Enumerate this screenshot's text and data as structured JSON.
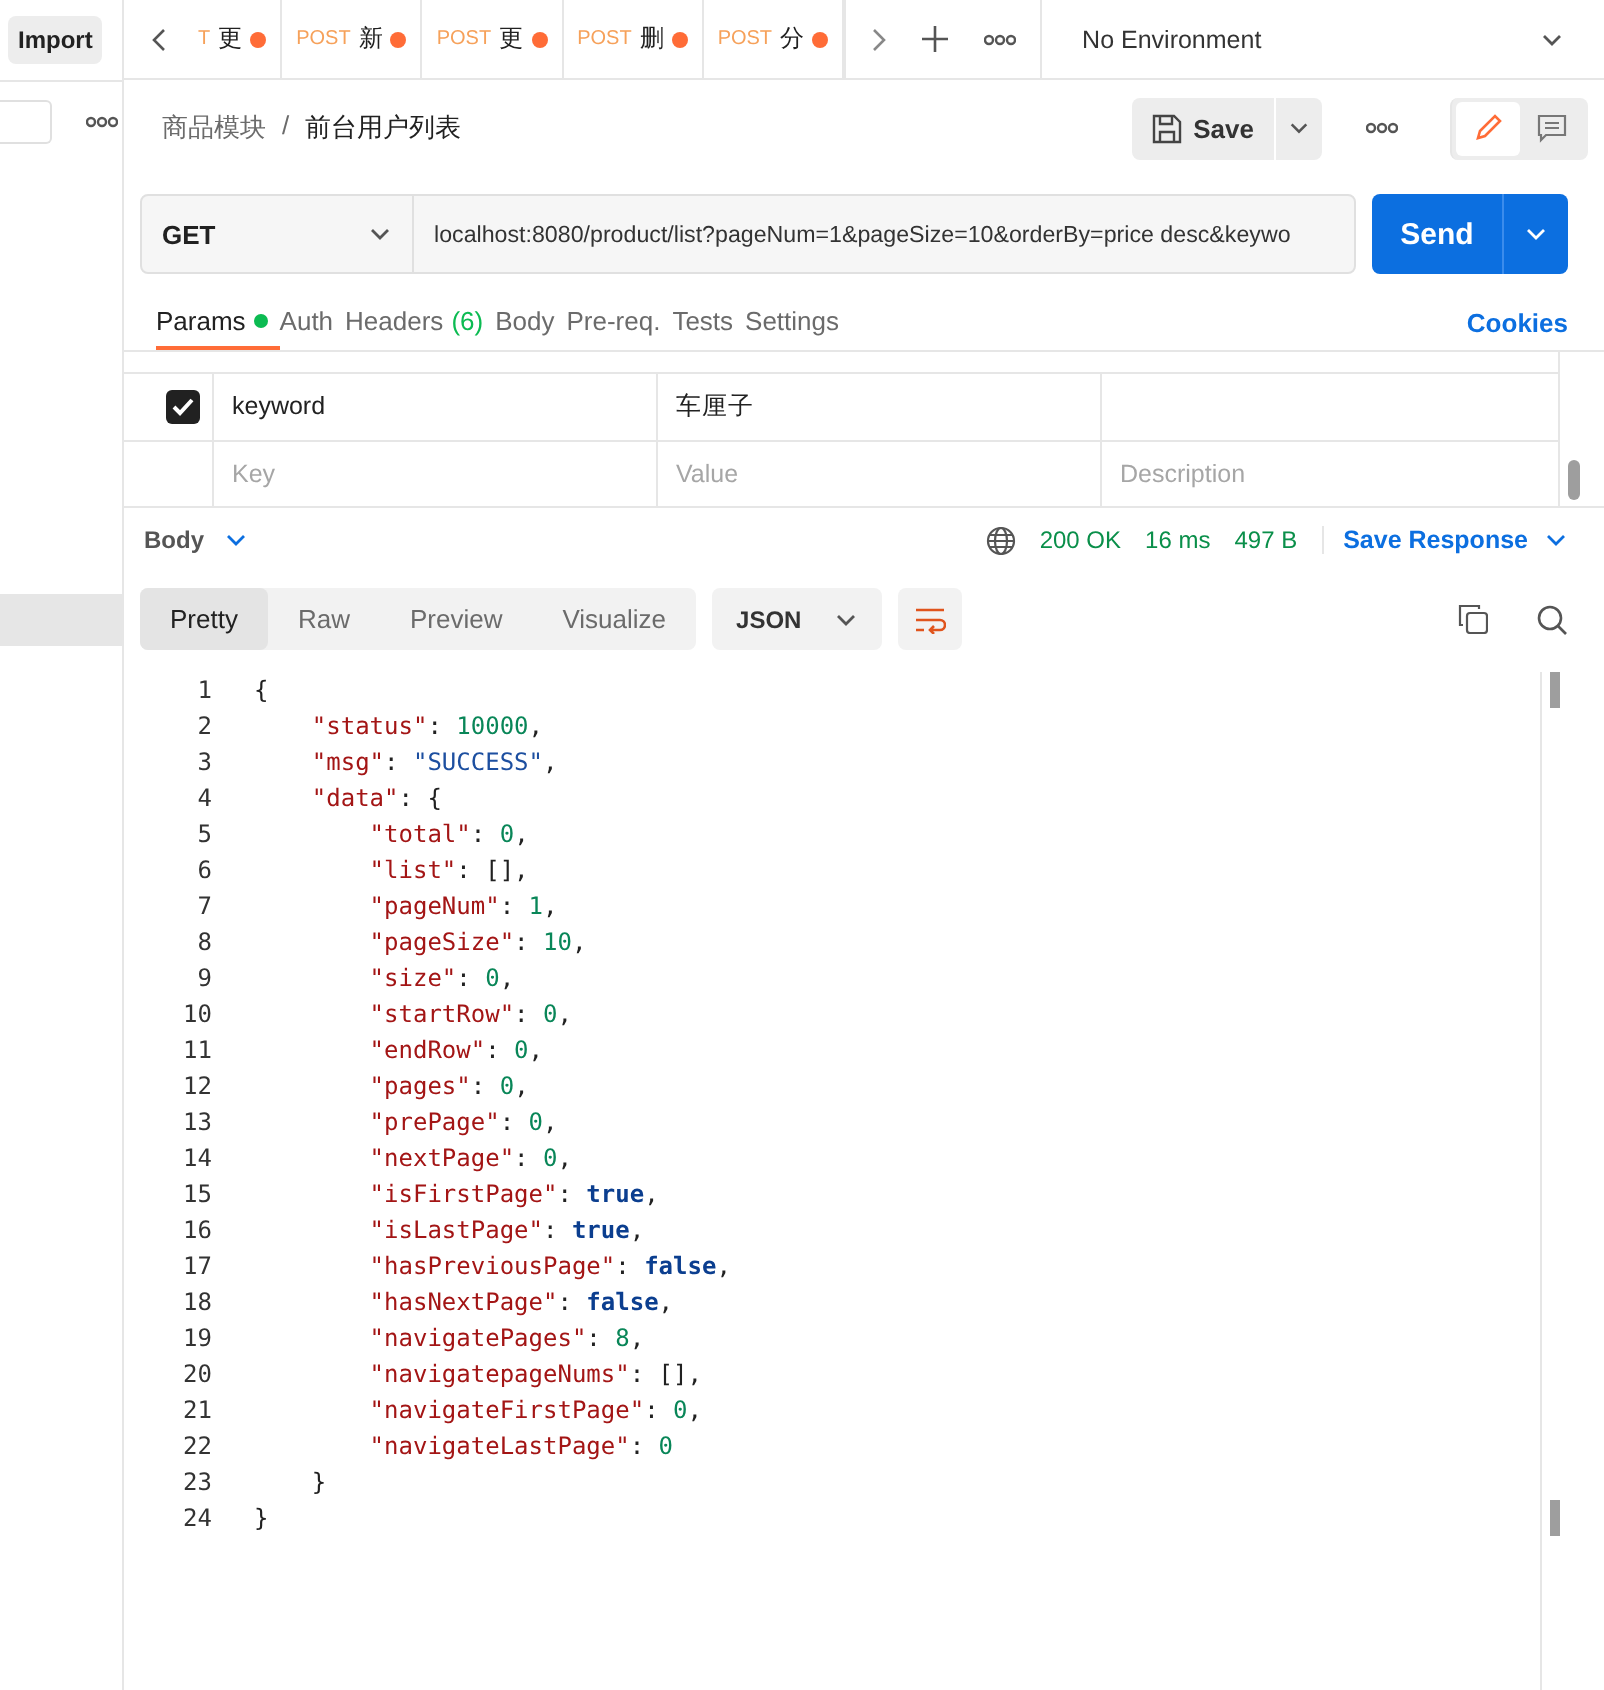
{
  "sidebar": {
    "import_button": "Import",
    "selected_row": true
  },
  "tabs": [
    {
      "method": "T",
      "name": "更",
      "unsaved": true,
      "selected": false
    },
    {
      "method": "POST",
      "name": "新",
      "unsaved": true,
      "selected": false
    },
    {
      "method": "POST",
      "name": "更",
      "unsaved": true,
      "selected": false
    },
    {
      "method": "POST",
      "name": "删",
      "unsaved": true,
      "selected": false
    },
    {
      "method": "POST",
      "name": "分",
      "unsaved": true,
      "selected": false
    }
  ],
  "environment": "No Environment",
  "breadcrumb": {
    "folder": "商品模块",
    "separator": "/",
    "request": "前台用户列表"
  },
  "save_button": "Save",
  "request": {
    "method": "GET",
    "url": "localhost:8080/product/list?pageNum=1&pageSize=10&orderBy=price desc&keywo"
  },
  "send_button": "Send",
  "request_tabs": [
    {
      "label": "Params",
      "dot": true,
      "selected": true
    },
    {
      "label": "Auth",
      "dot": false,
      "selected": false
    },
    {
      "label": "Headers",
      "count": "(6)",
      "dot": false,
      "selected": false
    },
    {
      "label": "Body",
      "dot": false,
      "selected": false
    },
    {
      "label": "Pre-req.",
      "dot": false,
      "selected": false
    },
    {
      "label": "Tests",
      "dot": false,
      "selected": false
    },
    {
      "label": "Settings",
      "dot": false,
      "selected": false
    }
  ],
  "cookies_link": "Cookies",
  "params": {
    "rows": [
      {
        "checked": true,
        "key": "keyword",
        "value": "车厘子"
      }
    ],
    "placeholders": {
      "key": "Key",
      "value": "Value",
      "description": "Description"
    }
  },
  "response": {
    "body_label": "Body",
    "status": "200 OK",
    "time": "16 ms",
    "size": "497 B",
    "save_response": "Save Response",
    "view_tabs": [
      {
        "label": "Pretty",
        "selected": true
      },
      {
        "label": "Raw",
        "selected": false
      },
      {
        "label": "Preview",
        "selected": false
      },
      {
        "label": "Visualize",
        "selected": false
      }
    ],
    "format": "JSON",
    "lines": [
      {
        "number": "1",
        "tokens": [
          {
            "kind": "punct",
            "text": "{"
          }
        ]
      },
      {
        "number": "2",
        "tokens": [
          {
            "kind": "key",
            "text": "    \"status\""
          },
          {
            "kind": "punct",
            "text": ": "
          },
          {
            "kind": "number",
            "text": "10000"
          },
          {
            "kind": "punct",
            "text": ","
          }
        ]
      },
      {
        "number": "3",
        "tokens": [
          {
            "kind": "key",
            "text": "    \"msg\""
          },
          {
            "kind": "punct",
            "text": ": "
          },
          {
            "kind": "string",
            "text": "\"SUCCESS\""
          },
          {
            "kind": "punct",
            "text": ","
          }
        ]
      },
      {
        "number": "4",
        "tokens": [
          {
            "kind": "key",
            "text": "    \"data\""
          },
          {
            "kind": "punct",
            "text": ": {"
          }
        ]
      },
      {
        "number": "5",
        "tokens": [
          {
            "kind": "key",
            "text": "        \"total\""
          },
          {
            "kind": "punct",
            "text": ": "
          },
          {
            "kind": "number",
            "text": "0"
          },
          {
            "kind": "punct",
            "text": ","
          }
        ]
      },
      {
        "number": "6",
        "tokens": [
          {
            "kind": "key",
            "text": "        \"list\""
          },
          {
            "kind": "punct",
            "text": ": [],"
          }
        ]
      },
      {
        "number": "7",
        "tokens": [
          {
            "kind": "key",
            "text": "        \"pageNum\""
          },
          {
            "kind": "punct",
            "text": ": "
          },
          {
            "kind": "number",
            "text": "1"
          },
          {
            "kind": "punct",
            "text": ","
          }
        ]
      },
      {
        "number": "8",
        "tokens": [
          {
            "kind": "key",
            "text": "        \"pageSize\""
          },
          {
            "kind": "punct",
            "text": ": "
          },
          {
            "kind": "number",
            "text": "10"
          },
          {
            "kind": "punct",
            "text": ","
          }
        ]
      },
      {
        "number": "9",
        "tokens": [
          {
            "kind": "key",
            "text": "        \"size\""
          },
          {
            "kind": "punct",
            "text": ": "
          },
          {
            "kind": "number",
            "text": "0"
          },
          {
            "kind": "punct",
            "text": ","
          }
        ]
      },
      {
        "number": "10",
        "tokens": [
          {
            "kind": "key",
            "text": "        \"startRow\""
          },
          {
            "kind": "punct",
            "text": ": "
          },
          {
            "kind": "number",
            "text": "0"
          },
          {
            "kind": "punct",
            "text": ","
          }
        ]
      },
      {
        "number": "11",
        "tokens": [
          {
            "kind": "key",
            "text": "        \"endRow\""
          },
          {
            "kind": "punct",
            "text": ": "
          },
          {
            "kind": "number",
            "text": "0"
          },
          {
            "kind": "punct",
            "text": ","
          }
        ]
      },
      {
        "number": "12",
        "tokens": [
          {
            "kind": "key",
            "text": "        \"pages\""
          },
          {
            "kind": "punct",
            "text": ": "
          },
          {
            "kind": "number",
            "text": "0"
          },
          {
            "kind": "punct",
            "text": ","
          }
        ]
      },
      {
        "number": "13",
        "tokens": [
          {
            "kind": "key",
            "text": "        \"prePage\""
          },
          {
            "kind": "punct",
            "text": ": "
          },
          {
            "kind": "number",
            "text": "0"
          },
          {
            "kind": "punct",
            "text": ","
          }
        ]
      },
      {
        "number": "14",
        "tokens": [
          {
            "kind": "key",
            "text": "        \"nextPage\""
          },
          {
            "kind": "punct",
            "text": ": "
          },
          {
            "kind": "number",
            "text": "0"
          },
          {
            "kind": "punct",
            "text": ","
          }
        ]
      },
      {
        "number": "15",
        "tokens": [
          {
            "kind": "key",
            "text": "        \"isFirstPage\""
          },
          {
            "kind": "punct",
            "text": ": "
          },
          {
            "kind": "bool",
            "text": "true"
          },
          {
            "kind": "punct",
            "text": ","
          }
        ]
      },
      {
        "number": "16",
        "tokens": [
          {
            "kind": "key",
            "text": "        \"isLastPage\""
          },
          {
            "kind": "punct",
            "text": ": "
          },
          {
            "kind": "bool",
            "text": "true"
          },
          {
            "kind": "punct",
            "text": ","
          }
        ]
      },
      {
        "number": "17",
        "tokens": [
          {
            "kind": "key",
            "text": "        \"hasPreviousPage\""
          },
          {
            "kind": "punct",
            "text": ": "
          },
          {
            "kind": "bool",
            "text": "false"
          },
          {
            "kind": "punct",
            "text": ","
          }
        ]
      },
      {
        "number": "18",
        "tokens": [
          {
            "kind": "key",
            "text": "        \"hasNextPage\""
          },
          {
            "kind": "punct",
            "text": ": "
          },
          {
            "kind": "bool",
            "text": "false"
          },
          {
            "kind": "punct",
            "text": ","
          }
        ]
      },
      {
        "number": "19",
        "tokens": [
          {
            "kind": "key",
            "text": "        \"navigatePages\""
          },
          {
            "kind": "punct",
            "text": ": "
          },
          {
            "kind": "number",
            "text": "8"
          },
          {
            "kind": "punct",
            "text": ","
          }
        ]
      },
      {
        "number": "20",
        "tokens": [
          {
            "kind": "key",
            "text": "        \"navigatepageNums\""
          },
          {
            "kind": "punct",
            "text": ": [],"
          }
        ]
      },
      {
        "number": "21",
        "tokens": [
          {
            "kind": "key",
            "text": "        \"navigateFirstPage\""
          },
          {
            "kind": "punct",
            "text": ": "
          },
          {
            "kind": "number",
            "text": "0"
          },
          {
            "kind": "punct",
            "text": ","
          }
        ]
      },
      {
        "number": "22",
        "tokens": [
          {
            "kind": "key",
            "text": "        \"navigateLastPage\""
          },
          {
            "kind": "punct",
            "text": ": "
          },
          {
            "kind": "number",
            "text": "0"
          }
        ]
      },
      {
        "number": "23",
        "tokens": [
          {
            "kind": "punct",
            "text": "    }"
          }
        ]
      },
      {
        "number": "24",
        "tokens": [
          {
            "kind": "punct",
            "text": "}"
          }
        ]
      }
    ]
  }
}
